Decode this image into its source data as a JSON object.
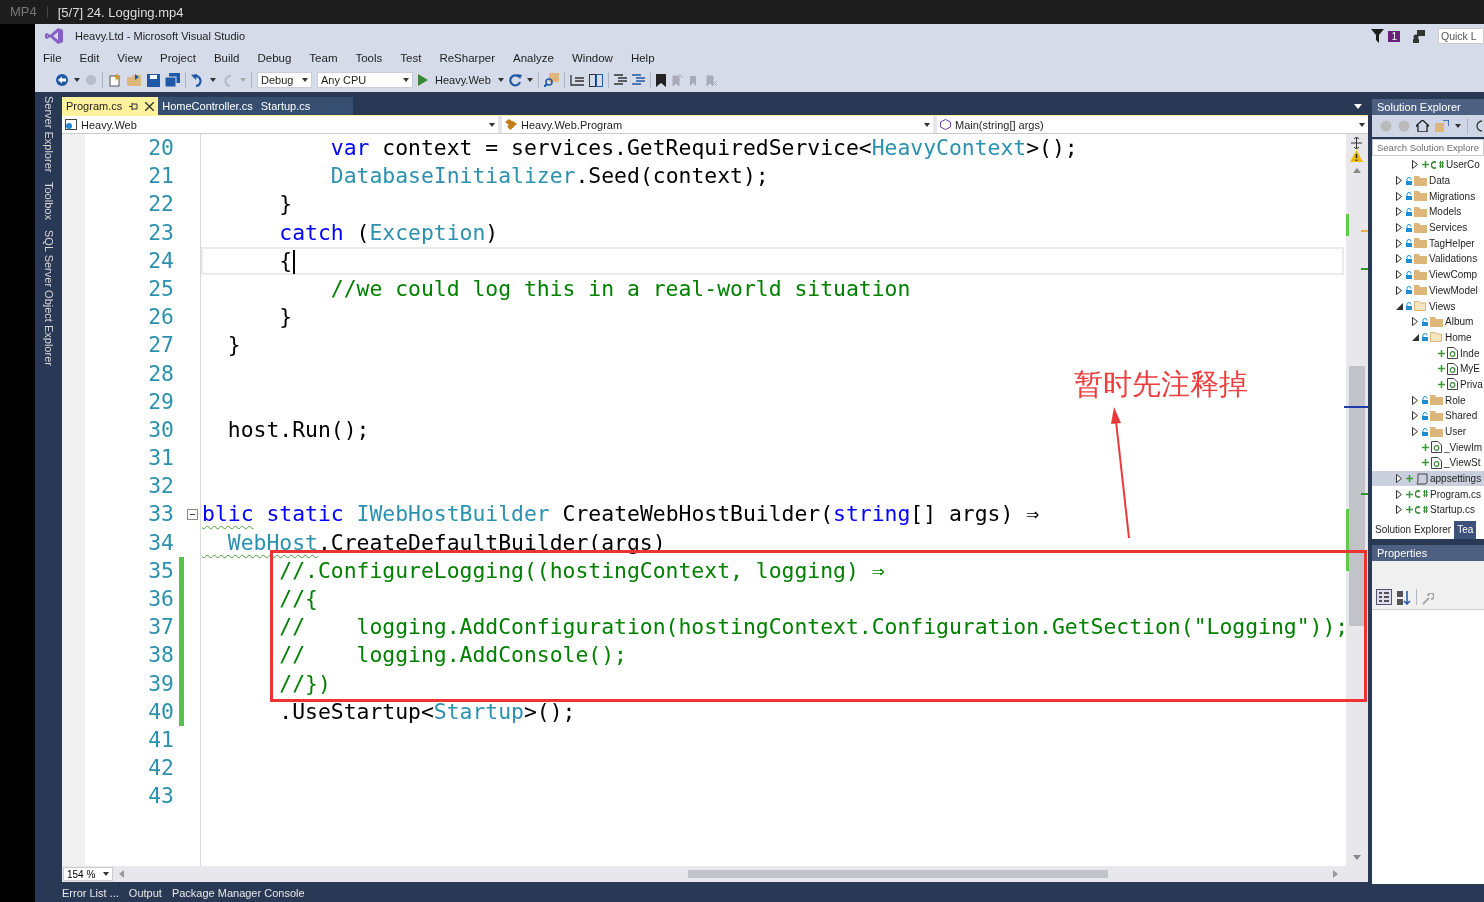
{
  "player": {
    "format": "MP4",
    "title": "[5/7] 24. Logging.mp4"
  },
  "window": {
    "title": "Heavy.Ltd - Microsoft Visual Studio",
    "notification_count": "1",
    "quick_launch_placeholder": "Quick L"
  },
  "menu": [
    "File",
    "Edit",
    "View",
    "Project",
    "Build",
    "Debug",
    "Team",
    "Tools",
    "Test",
    "ReSharper",
    "Analyze",
    "Window",
    "Help"
  ],
  "toolbar": {
    "configuration": "Debug",
    "platform": "Any CPU",
    "start_project": "Heavy.Web"
  },
  "side_tabs": [
    "Server Explorer",
    "Toolbox",
    "SQL Server Object Explorer"
  ],
  "editor": {
    "tabs": [
      {
        "label": "Program.cs",
        "selected": true
      },
      {
        "label": "HomeController.cs",
        "selected": false
      },
      {
        "label": "Startup.cs",
        "selected": false
      }
    ],
    "nav": [
      "Heavy.Web",
      "Heavy.Web.Program",
      "Main(string[] args)"
    ],
    "lines": [
      {
        "number": "20",
        "changed": false,
        "current": false,
        "segments": [
          {
            "text": "          var",
            "kind": "keyword"
          },
          {
            "text": " context = services.GetRequiredService<",
            "kind": "plain"
          },
          {
            "text": "HeavyContext",
            "kind": "type"
          },
          {
            "text": ">();",
            "kind": "plain"
          }
        ]
      },
      {
        "number": "21",
        "changed": false,
        "current": false,
        "segments": [
          {
            "text": "          DatabaseInitializer",
            "kind": "type"
          },
          {
            "text": ".Seed(context);",
            "kind": "plain"
          }
        ]
      },
      {
        "number": "22",
        "changed": false,
        "current": false,
        "segments": [
          {
            "text": "      }",
            "kind": "plain"
          }
        ]
      },
      {
        "number": "23",
        "changed": false,
        "current": false,
        "segments": [
          {
            "text": "      catch",
            "kind": "keyword"
          },
          {
            "text": " (",
            "kind": "plain"
          },
          {
            "text": "Exception",
            "kind": "type"
          },
          {
            "text": ")",
            "kind": "plain"
          }
        ]
      },
      {
        "number": "24",
        "changed": false,
        "current": true,
        "segments": [
          {
            "text": "      {",
            "kind": "plain"
          }
        ]
      },
      {
        "number": "25",
        "changed": false,
        "current": false,
        "segments": [
          {
            "text": "          //we could log this in a real-world situation",
            "kind": "comment"
          }
        ]
      },
      {
        "number": "26",
        "changed": false,
        "current": false,
        "segments": [
          {
            "text": "      }",
            "kind": "plain"
          }
        ]
      },
      {
        "number": "27",
        "changed": false,
        "current": false,
        "segments": [
          {
            "text": "  }",
            "kind": "plain"
          }
        ]
      },
      {
        "number": "28",
        "changed": false,
        "current": false
      },
      {
        "number": "29",
        "changed": false,
        "current": false
      },
      {
        "number": "30",
        "changed": false,
        "current": false,
        "segments": [
          {
            "text": "  host.Run();",
            "kind": "plain"
          }
        ]
      },
      {
        "number": "31",
        "changed": false,
        "current": false
      },
      {
        "number": "32",
        "changed": false,
        "current": false
      },
      {
        "number": "33",
        "changed": false,
        "current": false,
        "outline_expanded": true,
        "segments": [
          {
            "text": "blic",
            "kind": "keyword",
            "squiggle": true
          },
          {
            "text": " static",
            "kind": "keyword"
          },
          {
            "text": " IWebHostBuilder",
            "kind": "type"
          },
          {
            "text": " CreateWebHostBuilder(",
            "kind": "plain"
          },
          {
            "text": "string",
            "kind": "keyword"
          },
          {
            "text": "[] args) ⇒",
            "kind": "plain"
          }
        ]
      },
      {
        "number": "34",
        "changed": false,
        "current": false,
        "segments": [
          {
            "text": "  WebHost",
            "kind": "type",
            "squiggle": true
          },
          {
            "text": ".CreateDefaultBuilder(args)",
            "kind": "plain"
          }
        ]
      },
      {
        "number": "35",
        "changed": true,
        "current": false,
        "segments": [
          {
            "text": "      //.ConfigureLogging((hostingContext, logging) ⇒",
            "kind": "comment"
          }
        ]
      },
      {
        "number": "36",
        "changed": true,
        "current": false,
        "segments": [
          {
            "text": "      //{",
            "kind": "comment"
          }
        ]
      },
      {
        "number": "37",
        "changed": true,
        "current": false,
        "segments": [
          {
            "text": "      //    logging.AddConfiguration(hostingContext.Configuration.GetSection(\"Logging\"));",
            "kind": "comment"
          }
        ]
      },
      {
        "number": "38",
        "changed": true,
        "current": false,
        "segments": [
          {
            "text": "      //    logging.AddConsole();",
            "kind": "comment"
          }
        ]
      },
      {
        "number": "39",
        "changed": true,
        "current": false,
        "segments": [
          {
            "text": "      //})",
            "kind": "comment"
          }
        ]
      },
      {
        "number": "40",
        "changed": true,
        "current": false,
        "segments": [
          {
            "text": "      .UseStartup<",
            "kind": "plain"
          },
          {
            "text": "Startup",
            "kind": "type"
          },
          {
            "text": ">();",
            "kind": "plain"
          }
        ]
      },
      {
        "number": "41",
        "changed": false,
        "current": false
      },
      {
        "number": "42",
        "changed": false,
        "current": false
      },
      {
        "number": "43",
        "changed": false,
        "current": false
      }
    ],
    "zoom": "154 %"
  },
  "annotation": {
    "text": "暂时先注释掉"
  },
  "solution_explorer": {
    "title": "Solution Explorer",
    "search_placeholder": "Search Solution Explore",
    "scrolled_children": [
      {
        "label": "UserCo",
        "kind": "csharp",
        "expanded": false,
        "selected": false
      }
    ],
    "items": [
      {
        "label": "Data",
        "kind": "folder",
        "expanded": false,
        "selected": false
      },
      {
        "label": "Migrations",
        "kind": "folder",
        "expanded": false,
        "selected": false
      },
      {
        "label": "Models",
        "kind": "folder",
        "expanded": false,
        "selected": false
      },
      {
        "label": "Services",
        "kind": "folder",
        "expanded": false,
        "selected": false
      },
      {
        "label": "TagHelper",
        "kind": "folder",
        "expanded": false,
        "selected": false
      },
      {
        "label": "Validations",
        "kind": "folder",
        "expanded": false,
        "selected": false
      },
      {
        "label": "ViewComp",
        "kind": "folder",
        "expanded": false,
        "selected": false
      },
      {
        "label": "ViewModel",
        "kind": "folder",
        "expanded": false,
        "selected": false
      },
      {
        "label": "Views",
        "kind": "folder",
        "expanded": true,
        "selected": false,
        "children": [
          {
            "label": "Album",
            "kind": "folder",
            "expanded": false,
            "selected": false
          },
          {
            "label": "Home",
            "kind": "folder",
            "expanded": true,
            "selected": false,
            "children": [
              {
                "label": "Inde",
                "kind": "razor",
                "selected": false
              },
              {
                "label": "MyE",
                "kind": "razor",
                "selected": false
              },
              {
                "label": "Priva",
                "kind": "razor",
                "selected": false
              }
            ]
          },
          {
            "label": "Role",
            "kind": "folder",
            "expanded": false,
            "selected": false
          },
          {
            "label": "Shared",
            "kind": "folder",
            "expanded": false,
            "selected": false
          },
          {
            "label": "User",
            "kind": "folder",
            "expanded": false,
            "selected": false
          },
          {
            "label": "_ViewIm",
            "kind": "razor",
            "selected": false
          },
          {
            "label": "_ViewSt",
            "kind": "razor",
            "selected": false
          }
        ]
      },
      {
        "label": "appsettings",
        "kind": "json",
        "expanded": false,
        "selected": true
      },
      {
        "label": "Program.cs",
        "kind": "csharp",
        "expanded": false,
        "selected": false
      },
      {
        "label": "Startup.cs",
        "kind": "csharp",
        "expanded": false,
        "selected": false
      }
    ],
    "tabs": [
      {
        "label": "Solution Explorer",
        "selected": true
      },
      {
        "label": "Tea",
        "selected": false
      }
    ]
  },
  "properties": {
    "title": "Properties"
  },
  "bottom_tabs": [
    "Error List ...",
    "Output",
    "Package Manager Console"
  ]
}
